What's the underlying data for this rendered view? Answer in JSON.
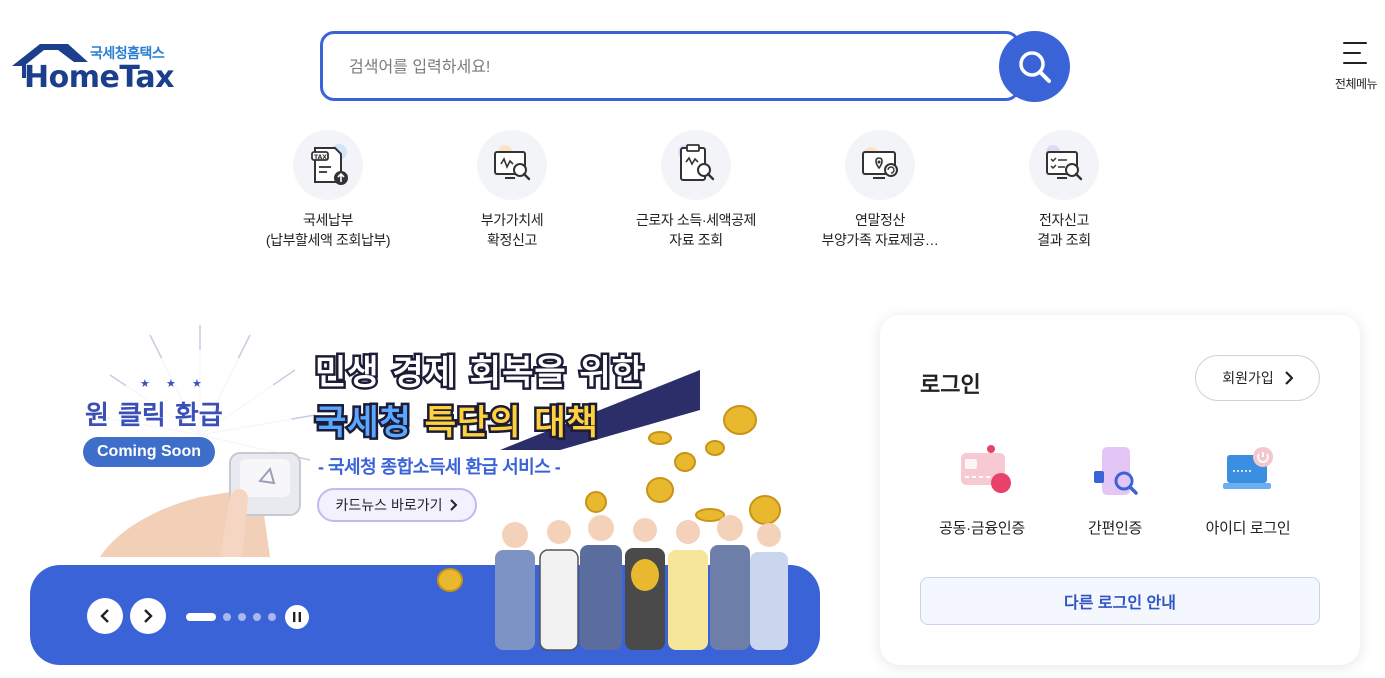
{
  "header": {
    "logo_sub": "국세청홈택스",
    "logo_main": "HomeTax",
    "search_placeholder": "검색어를 입력하세요!",
    "all_menu_label": "전체메뉴"
  },
  "quick_menu": [
    {
      "icon": "tax-payment-icon",
      "line1": "국세납부",
      "line2": "(납부할세액 조회납부)"
    },
    {
      "icon": "vat-search-icon",
      "line1": "부가가치세",
      "line2": "확정신고"
    },
    {
      "icon": "income-deduction-icon",
      "line1": "근로자 소득·세액공제",
      "line2": "자료 조회"
    },
    {
      "icon": "year-end-settlement-icon",
      "line1": "연말정산",
      "line2": "부양가족 자료제공…"
    },
    {
      "icon": "e-filing-result-icon",
      "line1": "전자신고",
      "line2": "결과 조회"
    }
  ],
  "banner": {
    "one_click": "원 클릭 환급",
    "coming_soon": "Coming Soon",
    "headline1": "민생 경제 회복을 위한",
    "headline2_part1": "국세청",
    "headline2_part2": "특단의 대책",
    "subline": "- 국세청 종합소득세 환급 서비스 -",
    "link_label": "카드뉴스 바로가기",
    "slide_count": 5,
    "active_slide": 1,
    "accent_color": "#3a63d8"
  },
  "login": {
    "title": "로그인",
    "join_label": "회원가입",
    "options": [
      {
        "icon": "certificate-card-icon",
        "label": "공동·금융인증"
      },
      {
        "icon": "phone-auth-icon",
        "label": "간편인증"
      },
      {
        "icon": "id-login-icon",
        "label": "아이디 로그인"
      }
    ],
    "other_login_label": "다른 로그인 안내"
  }
}
